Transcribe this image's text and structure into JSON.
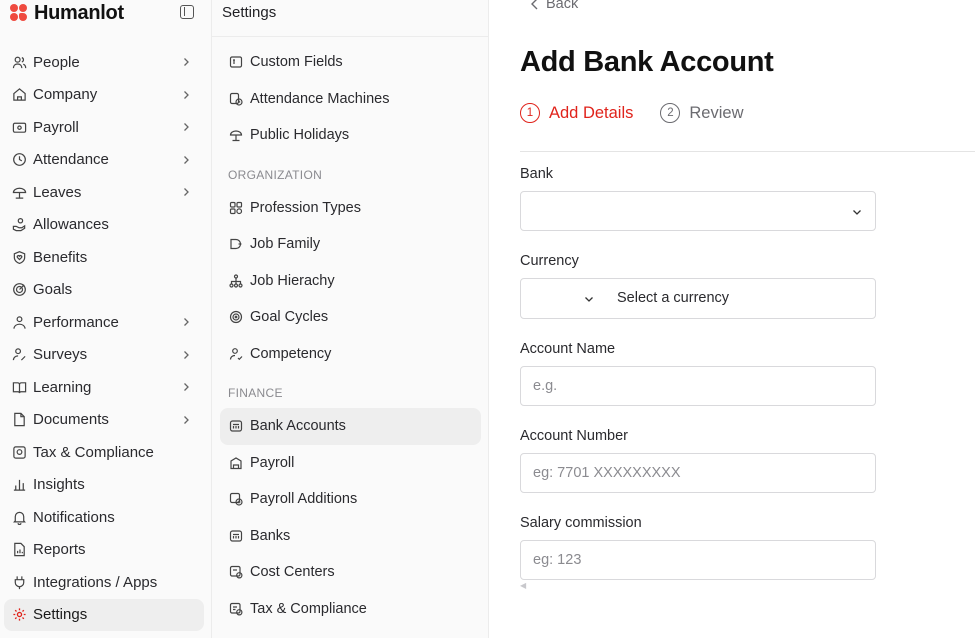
{
  "brand": {
    "name": "Humanlot"
  },
  "sidebar": {
    "items": [
      {
        "label": "People",
        "icon": "users-icon",
        "chevron": true
      },
      {
        "label": "Company",
        "icon": "home-icon",
        "chevron": true
      },
      {
        "label": "Payroll",
        "icon": "wallet-icon",
        "chevron": true
      },
      {
        "label": "Attendance",
        "icon": "clock-icon",
        "chevron": true
      },
      {
        "label": "Leaves",
        "icon": "umbrella-icon",
        "chevron": true
      },
      {
        "label": "Allowances",
        "icon": "hand-coins-icon",
        "chevron": false
      },
      {
        "label": "Benefits",
        "icon": "heart-shield-icon",
        "chevron": false
      },
      {
        "label": "Goals",
        "icon": "target-icon",
        "chevron": false
      },
      {
        "label": "Performance",
        "icon": "performance-icon",
        "chevron": true
      },
      {
        "label": "Surveys",
        "icon": "survey-icon",
        "chevron": true
      },
      {
        "label": "Learning",
        "icon": "book-icon",
        "chevron": true
      },
      {
        "label": "Documents",
        "icon": "document-icon",
        "chevron": true
      },
      {
        "label": "Tax & Compliance",
        "icon": "tax-icon",
        "chevron": false
      },
      {
        "label": "Insights",
        "icon": "bar-chart-icon",
        "chevron": false
      },
      {
        "label": "Notifications",
        "icon": "bell-icon",
        "chevron": false
      },
      {
        "label": "Reports",
        "icon": "report-icon",
        "chevron": false
      },
      {
        "label": "Integrations / Apps",
        "icon": "plug-icon",
        "chevron": false
      },
      {
        "label": "Settings",
        "icon": "gear-icon",
        "chevron": false,
        "active": true
      }
    ]
  },
  "settings": {
    "title": "Settings",
    "items_top": [
      "Custom Fields",
      "Attendance Machines",
      "Public Holidays"
    ],
    "group_org": "ORGANIZATION",
    "items_org": [
      "Profession Types",
      "Job Family",
      "Job Hierachy",
      "Goal Cycles",
      "Competency"
    ],
    "group_finance": "FINANCE",
    "items_finance": [
      "Bank Accounts",
      "Payroll",
      "Payroll Additions",
      "Banks",
      "Cost Centers",
      "Tax & Compliance"
    ]
  },
  "main": {
    "back_label": "Back",
    "title": "Add Bank Account",
    "steps": [
      {
        "num": "1",
        "label": "Add Details"
      },
      {
        "num": "2",
        "label": "Review"
      }
    ],
    "fields": {
      "bank_label": "Bank",
      "currency_label": "Currency",
      "currency_placeholder": "Select a currency",
      "account_name_label": "Account Name",
      "account_name_placeholder": "e.g.",
      "account_number_label": "Account Number",
      "account_number_placeholder": "eg: 7701 XXXXXXXXX",
      "salary_label": "Salary commission",
      "salary_placeholder": "eg: 123"
    }
  },
  "colors": {
    "accent": "#e0231b",
    "brand": "#ef4a3f"
  }
}
